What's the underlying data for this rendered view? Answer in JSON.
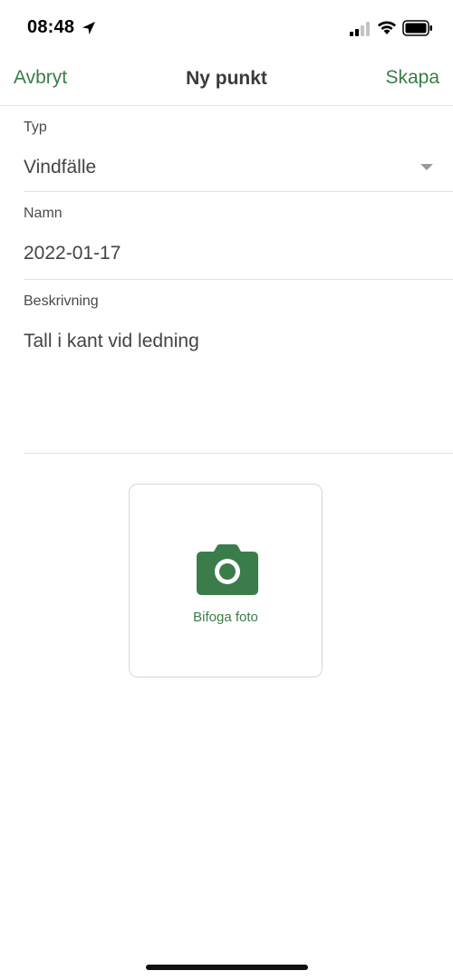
{
  "status_bar": {
    "time": "08:48"
  },
  "nav": {
    "cancel_label": "Avbryt",
    "title": "Ny punkt",
    "create_label": "Skapa"
  },
  "form": {
    "type": {
      "label": "Typ",
      "value": "Vindfälle"
    },
    "name": {
      "label": "Namn",
      "value": "2022-01-17"
    },
    "description": {
      "label": "Beskrivning",
      "value": "Tall i kant vid ledning"
    }
  },
  "photo": {
    "label": "Bifoga foto",
    "icon": "camera-icon"
  },
  "colors": {
    "accent": "#3a7d4a",
    "text": "#3a3a3a",
    "divider": "#e2e2e2"
  }
}
